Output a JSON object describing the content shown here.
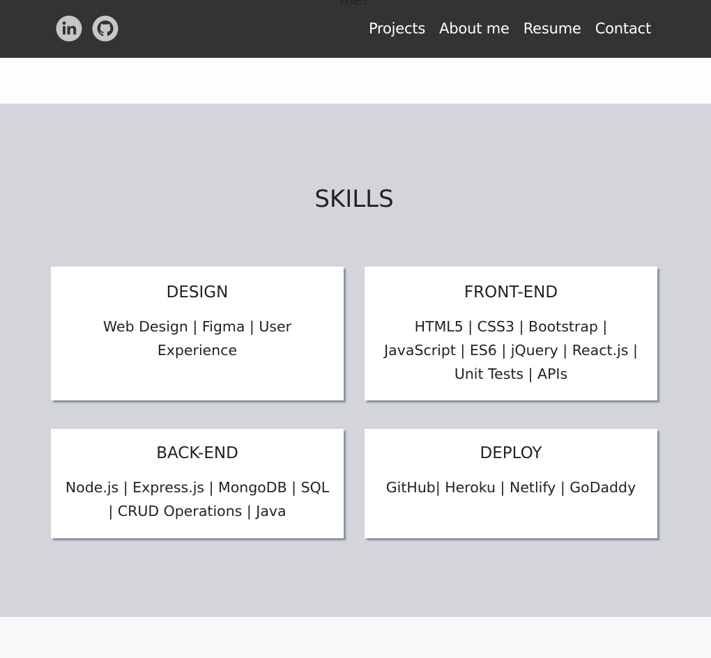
{
  "clipped_text": "me!",
  "navbar": {
    "social": [
      {
        "name": "linkedin",
        "icon": "linkedin-icon"
      },
      {
        "name": "github",
        "icon": "github-icon"
      }
    ],
    "links": [
      {
        "label": "Projects"
      },
      {
        "label": "About me"
      },
      {
        "label": "Resume"
      },
      {
        "label": "Contact"
      }
    ]
  },
  "skills": {
    "title": "SKILLS",
    "cards": [
      {
        "heading": "DESIGN",
        "text": "Web Design | Figma | User Experience"
      },
      {
        "heading": "FRONT-END",
        "text": "HTML5 | CSS3 | Bootstrap | JavaScript | ES6 | jQuery | React.js | Unit Tests | APIs"
      },
      {
        "heading": "BACK-END",
        "text": "Node.js | Express.js | MongoDB | SQL | CRUD Operations | Java"
      },
      {
        "heading": "DEPLOY",
        "text": "GitHub| Heroku | Netlify | GoDaddy"
      }
    ]
  },
  "colors": {
    "navbar_bg": "#333333",
    "skills_bg": "#d3d5da",
    "card_bg": "#ffffff",
    "icon_fill": "#c7c7c7"
  }
}
